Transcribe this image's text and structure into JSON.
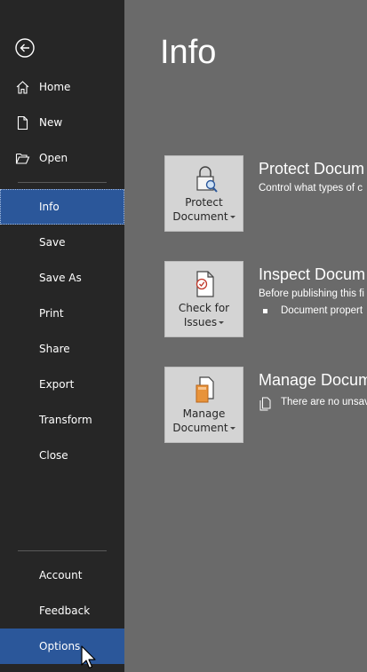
{
  "nav": {
    "top_items": [
      {
        "label": "Home",
        "icon": "home-icon"
      },
      {
        "label": "New",
        "icon": "new-document-icon"
      },
      {
        "label": "Open",
        "icon": "open-folder-icon"
      }
    ],
    "main_items": [
      {
        "label": "Info",
        "selected": true
      },
      {
        "label": "Save"
      },
      {
        "label": "Save As"
      },
      {
        "label": "Print"
      },
      {
        "label": "Share"
      },
      {
        "label": "Export"
      },
      {
        "label": "Transform"
      },
      {
        "label": "Close"
      }
    ],
    "bottom_items": [
      {
        "label": "Account"
      },
      {
        "label": "Feedback"
      },
      {
        "label": "Options",
        "hovered": true
      }
    ]
  },
  "main": {
    "title": "Info",
    "sections": [
      {
        "button_line1": "Protect",
        "button_line2": "Document",
        "icon": "lock-magnifier-icon",
        "heading": "Protect Docum",
        "description": "Control what types of c"
      },
      {
        "button_line1": "Check for",
        "button_line2": "Issues",
        "icon": "document-check-icon",
        "heading": "Inspect Docum",
        "description": "Before publishing this fi",
        "bullet_item": "Document propert"
      },
      {
        "button_line1": "Manage",
        "button_line2": "Document",
        "icon": "manage-document-icon",
        "heading": "Manage Docum",
        "item_text": "There are no unsav"
      }
    ]
  },
  "colors": {
    "nav_bg": "#262626",
    "selected": "#2b579a",
    "main_bg": "#6a6a6a",
    "tile_bg": "#d4d4d4"
  }
}
